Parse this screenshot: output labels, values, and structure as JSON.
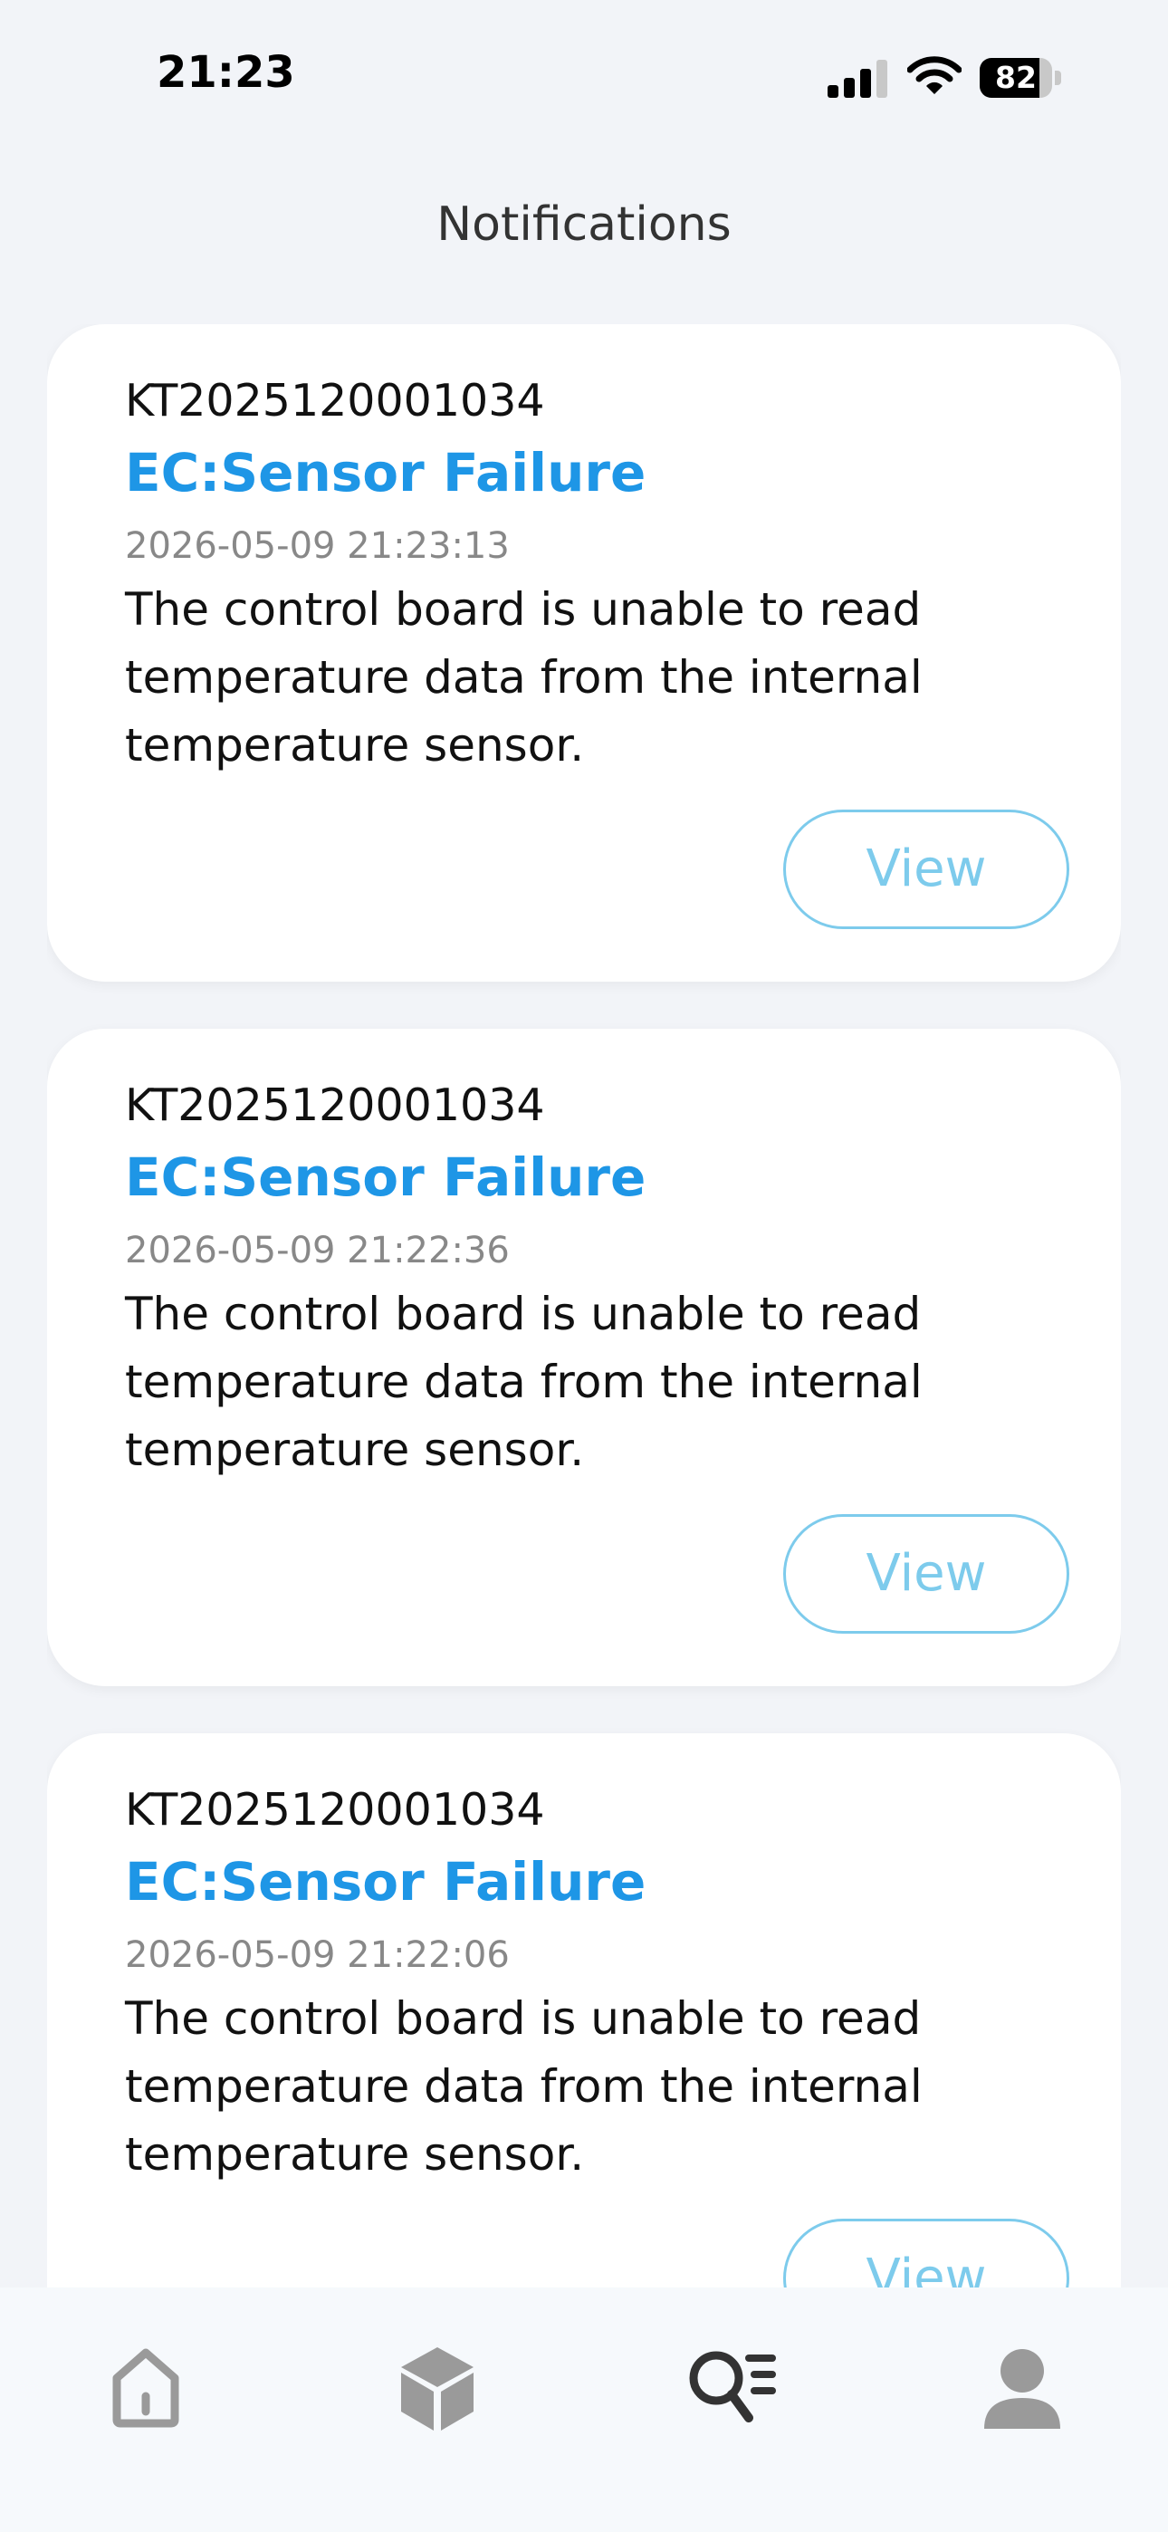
{
  "status_bar": {
    "time": "21:23",
    "battery_level": "82",
    "icons": [
      "signal-icon",
      "wifi-icon",
      "battery-icon"
    ]
  },
  "header": {
    "title": "Notifications"
  },
  "notifications": [
    {
      "serial": "KT2025120001034",
      "title": "EC:Sensor Failure",
      "timestamp": "2026-05-09 21:23:13",
      "description": "The control board is unable to read temperature data from the internal temperature sensor.",
      "action_label": "View"
    },
    {
      "serial": "KT2025120001034",
      "title": "EC:Sensor Failure",
      "timestamp": "2026-05-09 21:22:36",
      "description": "The control board is unable to read temperature data from the internal temperature sensor.",
      "action_label": "View"
    },
    {
      "serial": "KT2025120001034",
      "title": "EC:Sensor Failure",
      "timestamp": "2026-05-09 21:22:06",
      "description": "The control board is unable to read temperature data from the internal temperature sensor.",
      "action_label": "View"
    }
  ],
  "tab_bar": {
    "tabs": [
      {
        "icon": "home-icon",
        "active": false
      },
      {
        "icon": "box-icon",
        "active": false
      },
      {
        "icon": "search-list-icon",
        "active": true
      },
      {
        "icon": "user-icon",
        "active": false
      }
    ]
  },
  "colors": {
    "accent": "#1e96e6",
    "view_button": "#7dcbec",
    "background": "#f2f4f8",
    "tab_inactive": "#9a9a9a",
    "tab_active": "#333333"
  }
}
